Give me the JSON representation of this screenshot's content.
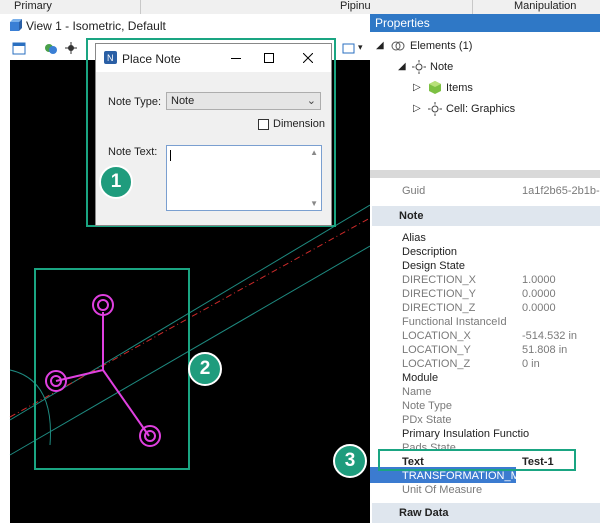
{
  "ribbon": {
    "primary": "Primary",
    "piping": "Pipinu",
    "manipulation": "Manipulation"
  },
  "view": {
    "title": "View 1 - Isometric, Default"
  },
  "dialog": {
    "title": "Place Note",
    "note_type_label": "Note Type:",
    "note_type_value": "Note",
    "dimension_label": "Dimension",
    "note_text_label": "Note Text:",
    "note_text_value": ""
  },
  "badges": [
    "1",
    "2",
    "3"
  ],
  "properties": {
    "title": "Properties",
    "tree": [
      {
        "label": "Elements (1)",
        "icon": "elements-icon"
      },
      {
        "label": "Note",
        "icon": "sun-icon"
      },
      {
        "label": "Items",
        "icon": "cube-icon"
      },
      {
        "label": "Cell: Graphics",
        "icon": "sun-icon"
      }
    ],
    "guid_label": "Guid",
    "guid_value": "1a1f2b65-2b1b-",
    "section_note": "Note",
    "rows": [
      {
        "k": "Alias",
        "v": "",
        "grey": false
      },
      {
        "k": "Description",
        "v": "",
        "grey": false
      },
      {
        "k": "Design State",
        "v": "",
        "grey": false
      },
      {
        "k": "DIRECTION_X",
        "v": "1.0000",
        "grey": true
      },
      {
        "k": "DIRECTION_Y",
        "v": "0.0000",
        "grey": true
      },
      {
        "k": "DIRECTION_Z",
        "v": "0.0000",
        "grey": true
      },
      {
        "k": "Functional InstanceId",
        "v": "",
        "grey": true
      },
      {
        "k": "LOCATION_X",
        "v": "-514.532 in",
        "grey": true
      },
      {
        "k": "LOCATION_Y",
        "v": "51.808 in",
        "grey": true
      },
      {
        "k": "LOCATION_Z",
        "v": "0 in",
        "grey": true
      },
      {
        "k": "Module",
        "v": "",
        "grey": false
      },
      {
        "k": "Name",
        "v": "",
        "grey": true
      },
      {
        "k": "Note Type",
        "v": "",
        "grey": true
      },
      {
        "k": "PDx State",
        "v": "",
        "grey": true
      },
      {
        "k": "Primary Insulation Functio",
        "v": "",
        "grey": false
      },
      {
        "k": "Pads State",
        "v": "",
        "grey": true
      },
      {
        "k": "Text",
        "v": "Test-1",
        "grey": false
      },
      {
        "k": "TRANSFORMATION_MA",
        "v": "",
        "grey": false
      },
      {
        "k": "Unit Of Measure",
        "v": "",
        "grey": true
      }
    ],
    "section_raw": "Raw Data"
  }
}
